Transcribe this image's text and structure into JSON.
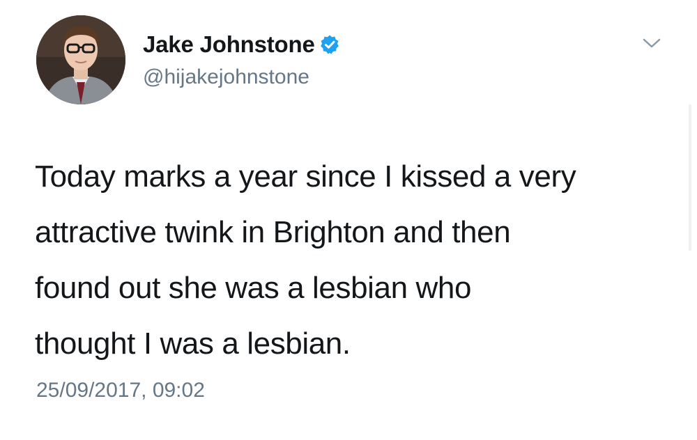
{
  "tweet": {
    "author": {
      "display_name": "Jake Johnstone",
      "handle": "@hijakejohnstone",
      "verified": true,
      "avatar_icon": "profile-photo"
    },
    "menu_icon": "chevron-down-icon",
    "text_lines": [
      "Today marks a year since I kissed a very",
      "attractive twink in Brighton and then",
      "found out she was a lesbian who",
      "thought I was a lesbian."
    ],
    "timestamp": "25/09/2017, 09:02"
  },
  "colors": {
    "text": "#14171a",
    "secondary_text": "#657786",
    "verified_blue": "#1da1f2",
    "background": "#ffffff"
  }
}
